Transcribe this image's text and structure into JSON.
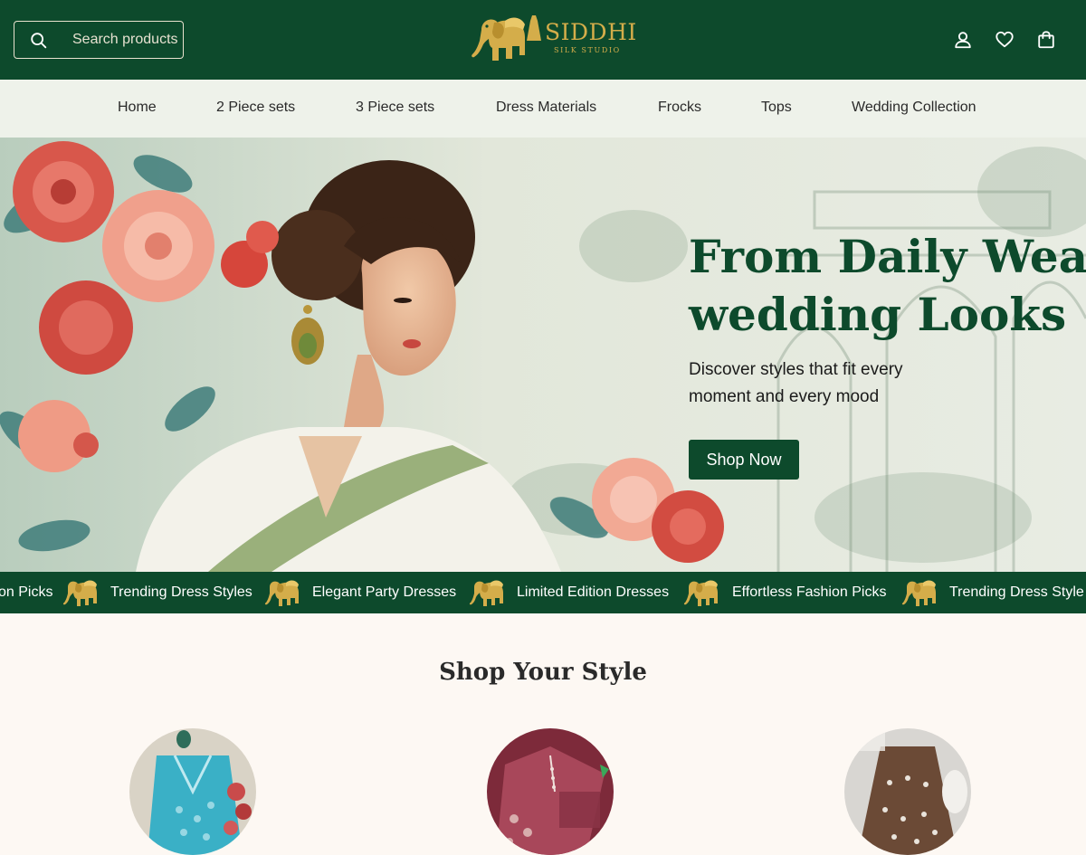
{
  "header": {
    "search_placeholder": "Search products",
    "logo": {
      "name": "SIDDHI",
      "tagline": "SILK STUDIO"
    },
    "icons": [
      "search-icon",
      "account-icon",
      "wishlist-heart-icon",
      "cart-bag-icon"
    ]
  },
  "nav": {
    "items": [
      {
        "label": "Home"
      },
      {
        "label": "2 Piece sets"
      },
      {
        "label": "3 Piece sets"
      },
      {
        "label": "Dress Materials"
      },
      {
        "label": "Frocks"
      },
      {
        "label": "Tops"
      },
      {
        "label": "Wedding Collection"
      }
    ]
  },
  "hero": {
    "title_line1": "From Daily Wear to",
    "title_line2": "wedding Looks",
    "subtitle": "Discover styles that fit every moment and every mood",
    "cta": "Shop Now"
  },
  "marquee": {
    "items": [
      "on Picks",
      "Trending Dress Styles",
      "Elegant Party Dresses",
      "Limited Edition Dresses",
      "Effortless Fashion Picks",
      "Trending Dress Style"
    ],
    "separator_icon": "elephant-icon"
  },
  "section": {
    "title": "Shop Your Style",
    "categories": [
      {
        "image": "turquoise-embroidered-suit"
      },
      {
        "image": "maroon-dress-material"
      },
      {
        "image": "brown-embroidered-frock"
      }
    ]
  },
  "colors": {
    "brand_green": "#0d4a2c",
    "gold": "#d4ad4a",
    "nav_bg": "#eef2ea",
    "page_bg": "#fdf8f3"
  }
}
